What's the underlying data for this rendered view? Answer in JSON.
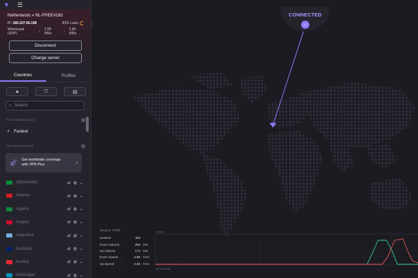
{
  "header": {
    "menu_icon": "hamburger-icon",
    "logo_icon": "protonvpn-logo-icon"
  },
  "connection": {
    "server": "Netherlands » NL-FREE#162",
    "ip_label": "IP:",
    "ip": "185.107.56.158",
    "load": "82% Load",
    "protocol": "WireGuard (UDP)",
    "down_rate": "2.59 KB/s",
    "up_rate": "2.83 KB/s",
    "disconnect_label": "Disconnect",
    "change_label": "Change server",
    "status": "CONNECTED"
  },
  "tabs": [
    {
      "label": "Countries"
    },
    {
      "label": "Profiles"
    }
  ],
  "search": {
    "placeholder": "Search"
  },
  "sections": {
    "free": "Free connections (1)",
    "plus": "Plus locations (115)"
  },
  "fastest": "Fastest",
  "promo": {
    "line1": "Get worldwide coverage",
    "line2": "with VPN Plus"
  },
  "countries": [
    {
      "name": "Afghanistan",
      "color": "#0a8f3a"
    },
    {
      "name": "Albania",
      "color": "#d11c24"
    },
    {
      "name": "Algeria",
      "color": "#0c8a3c"
    },
    {
      "name": "Angola",
      "color": "#c8102e"
    },
    {
      "name": "Argentina",
      "color": "#74acdf"
    },
    {
      "name": "Australia",
      "color": "#012169"
    },
    {
      "name": "Austria",
      "color": "#ed2939"
    },
    {
      "name": "Azerbaijan",
      "color": "#0092bc"
    }
  ],
  "traffic": {
    "title": "Session Traffic",
    "rows": [
      {
        "label": "Session:",
        "value": "33s",
        "unit": ""
      },
      {
        "label": "Down Volume:",
        "value": "264",
        "unit": "MB"
      },
      {
        "label": "Up Volume:",
        "value": "171",
        "unit": "MB"
      },
      {
        "label": "Down Speed:",
        "value": "2.59",
        "unit": "KB/s"
      },
      {
        "label": "Up Speed:",
        "value": "2.83",
        "unit": "KB/s"
      }
    ],
    "graph_top_label": "Speed",
    "graph_bottom_label": "60 Seconds"
  },
  "colors": {
    "accent": "#8b7cff",
    "down": "#39c79b",
    "up": "#ef5a5a"
  }
}
